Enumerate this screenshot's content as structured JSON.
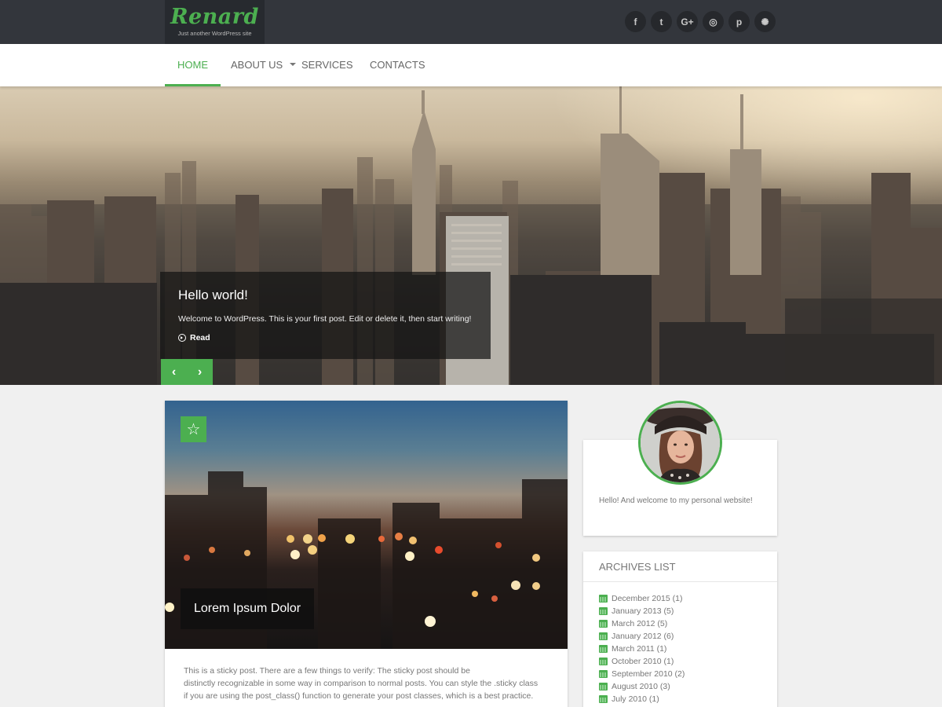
{
  "header": {
    "site_title": "Renard",
    "tagline": "Just another WordPress site",
    "social": [
      {
        "label": "f",
        "icon": "facebook-icon"
      },
      {
        "label": "t",
        "icon": "twitter-icon"
      },
      {
        "label": "G+",
        "icon": "google-plus-icon"
      },
      {
        "label": "◎",
        "icon": "instagram-icon"
      },
      {
        "label": "p",
        "icon": "pinterest-icon"
      },
      {
        "label": "✺",
        "icon": "dribbble-icon"
      }
    ]
  },
  "nav": {
    "items": [
      {
        "label": "HOME",
        "active": true
      },
      {
        "label": "ABOUT US",
        "has_dropdown": true
      },
      {
        "label": "SERVICES"
      },
      {
        "label": "CONTACTS"
      }
    ]
  },
  "slider": {
    "title": "Hello world!",
    "text": "Welcome to WordPress. This is your first post. Edit or delete it, then start writing!",
    "read_label": "Read",
    "prev_label": "‹",
    "next_label": "›"
  },
  "post": {
    "title": "Lorem Ipsum Dolor",
    "sticky_icon": "☆",
    "excerpt_lines": [
      "This is a sticky post. There are a few things to verify: The sticky post should be",
      "distinctly recognizable in some way in comparison to normal posts. You can style the .sticky class",
      "if you are using the post_class() function to generate your post classes, which is a best practice."
    ]
  },
  "sidebar": {
    "about_text": "Hello! And welcome to my personal website!",
    "archives_title": "ARCHIVES LIST",
    "archives": [
      "December 2015 (1)",
      "January 2013 (5)",
      "March 2012 (5)",
      "January 2012 (6)",
      "March 2011 (1)",
      "October 2010 (1)",
      "September 2010 (2)",
      "August 2010 (3)",
      "July 2010 (1)"
    ]
  },
  "colors": {
    "accent": "#4caf50",
    "topbar": "#33363c"
  }
}
